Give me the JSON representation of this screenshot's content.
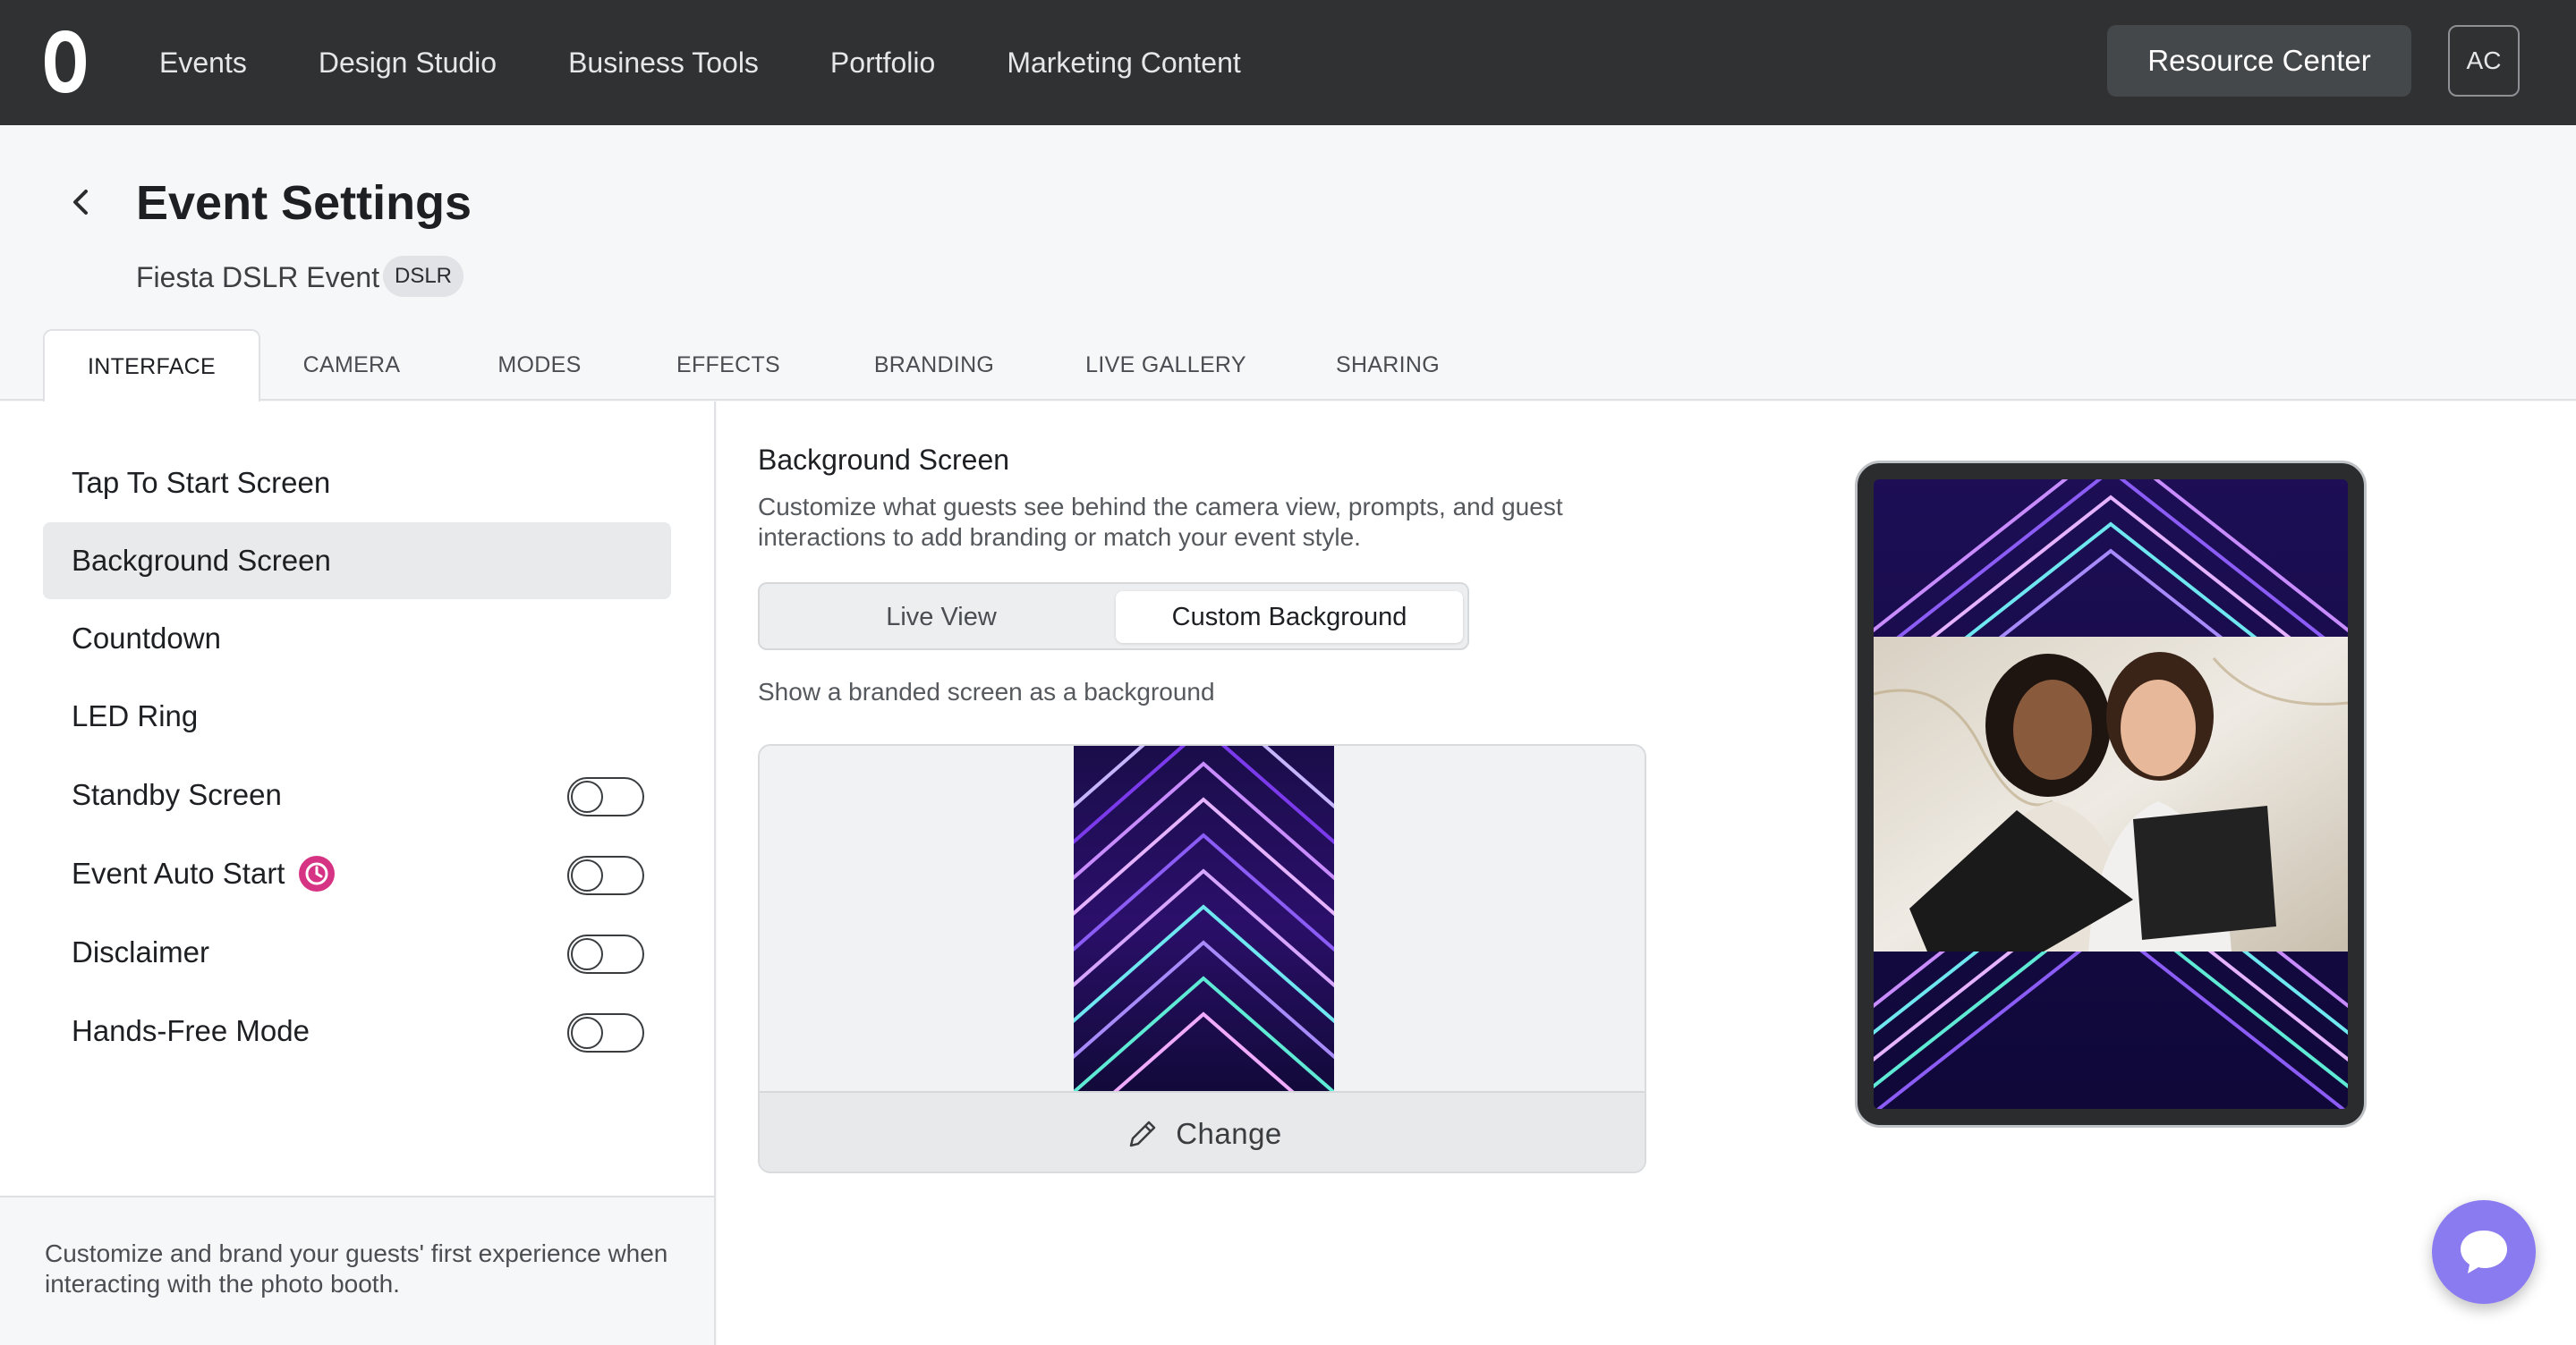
{
  "nav": {
    "items": [
      "Events",
      "Design Studio",
      "Business Tools",
      "Portfolio",
      "Marketing Content"
    ],
    "resource_center": "Resource Center",
    "avatar_initials": "AC"
  },
  "header": {
    "title": "Event Settings",
    "event_name": "Fiesta DSLR Event",
    "badge": "DSLR"
  },
  "tabs": [
    "INTERFACE",
    "CAMERA",
    "MODES",
    "EFFECTS",
    "BRANDING",
    "LIVE GALLERY",
    "SHARING"
  ],
  "sidebar": {
    "items": [
      {
        "label": "Tap To Start Screen"
      },
      {
        "label": "Background Screen"
      },
      {
        "label": "Countdown"
      },
      {
        "label": "LED Ring"
      },
      {
        "label": "Standby Screen"
      },
      {
        "label": "Event Auto Start"
      },
      {
        "label": "Disclaimer"
      },
      {
        "label": "Hands-Free Mode"
      }
    ],
    "footer": "Customize and brand your guests' first experience when interacting with the photo booth."
  },
  "main": {
    "title": "Background Screen",
    "description": "Customize what guests see behind the camera view, prompts, and guest interactions to add branding or match your event style.",
    "segments": [
      "Live View",
      "Custom Background"
    ],
    "show_label": "Show a branded screen as a background",
    "change_label": "Change"
  },
  "colors": {
    "navbar": "#2f3133",
    "accent_purple": "#8a7cf0",
    "clock_pink": "#d63384"
  }
}
